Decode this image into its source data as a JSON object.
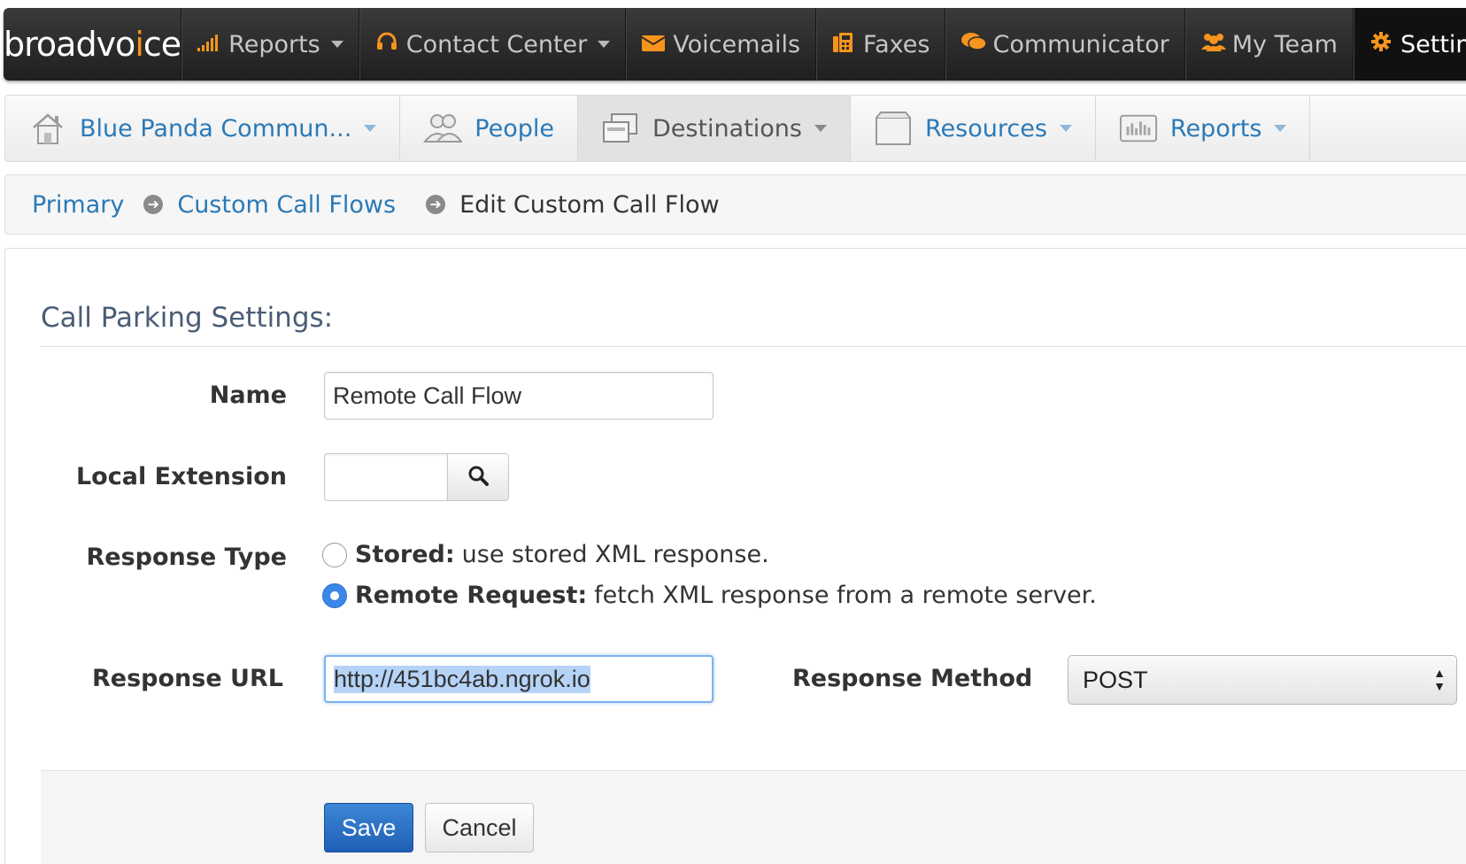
{
  "topnav": {
    "brand_left": "broadvo",
    "brand_dot": "i",
    "brand_right": "ce",
    "items": [
      {
        "label": "Reports",
        "icon": "signal-bars-icon",
        "dropdown": true
      },
      {
        "label": "Contact Center",
        "icon": "headset-icon",
        "dropdown": true
      },
      {
        "label": "Voicemails",
        "icon": "envelope-icon"
      },
      {
        "label": "Faxes",
        "icon": "fax-icon"
      },
      {
        "label": "Communicator",
        "icon": "chat-bubbles-icon"
      },
      {
        "label": "My Team",
        "icon": "group-icon"
      },
      {
        "label": "Settings",
        "icon": "gear-icon",
        "active": true
      }
    ]
  },
  "subnav": {
    "items": [
      {
        "label": "Blue Panda Commun...",
        "icon": "house-icon",
        "dropdown": true
      },
      {
        "label": "People",
        "icon": "people-icon"
      },
      {
        "label": "Destinations",
        "icon": "destinations-icon",
        "dropdown": true,
        "active": true
      },
      {
        "label": "Resources",
        "icon": "box-icon",
        "dropdown": true
      },
      {
        "label": "Reports",
        "icon": "report-chart-icon",
        "dropdown": true
      }
    ]
  },
  "breadcrumb": {
    "primary": "Primary",
    "custom_call_flows": "Custom Call Flows",
    "current": "Edit Custom Call Flow"
  },
  "form": {
    "section_title": "Call Parking Settings:",
    "name_label": "Name",
    "name_value": "Remote Call Flow",
    "local_extension_label": "Local Extension",
    "local_extension_value": "",
    "response_type_label": "Response Type",
    "stored_bold": "Stored:",
    "stored_text": "use stored XML response.",
    "remote_bold": "Remote Request:",
    "remote_text": "fetch XML response from a remote server.",
    "selected_response_type": "remote",
    "response_url_label": "Response URL",
    "response_url_value": "http://451bc4ab.ngrok.io",
    "response_method_label": "Response Method",
    "response_method_value": "POST",
    "save_label": "Save",
    "cancel_label": "Cancel"
  },
  "colors": {
    "accent_orange": "#f7941d",
    "link_blue": "#2a7ab8",
    "primary_button": "#2a6fc4"
  }
}
